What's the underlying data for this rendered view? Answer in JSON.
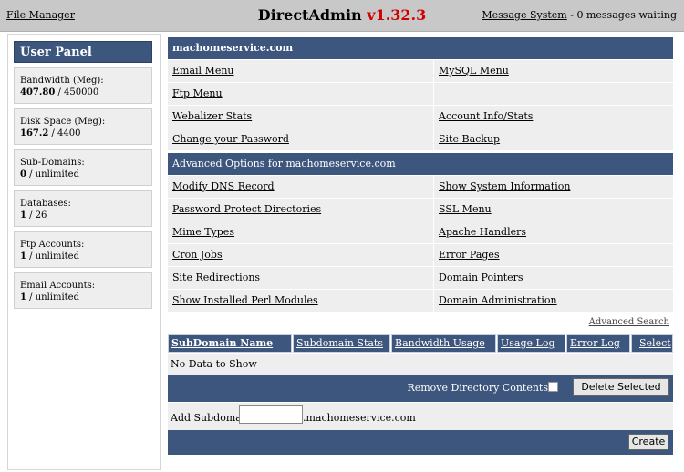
{
  "topbar": {
    "file_manager": "File Manager",
    "title_name": "DirectAdmin",
    "title_version": "v1.32.3",
    "message_system": "Message System",
    "messages_waiting": "- 0 messages waiting"
  },
  "sidebar": {
    "title": "User Panel",
    "stats": [
      {
        "label": "Bandwidth (Meg):",
        "used": "407.80",
        "limit": " / 450000"
      },
      {
        "label": "Disk Space (Meg):",
        "used": "167.2",
        "limit": " / 4400"
      },
      {
        "label": "Sub-Domains:",
        "used": "0",
        "limit": " / unlimited"
      },
      {
        "label": "Databases:",
        "used": "1",
        "limit": " / 26"
      },
      {
        "label": "Ftp Accounts:",
        "used": "1",
        "limit": " / unlimited"
      },
      {
        "label": "Email Accounts:",
        "used": "1",
        "limit": " / unlimited"
      }
    ]
  },
  "domain_header": "machomeservice.com",
  "menu_rows": [
    {
      "left": "Email Menu",
      "right": "MySQL Menu"
    },
    {
      "left": "Ftp Menu",
      "right": ""
    },
    {
      "left": "Webalizer Stats",
      "right": "Account Info/Stats"
    },
    {
      "left": "Change your Password",
      "right": "Site Backup"
    }
  ],
  "advanced_header": "Advanced Options for machomeservice.com",
  "advanced_rows": [
    {
      "left": "Modify DNS Record",
      "right": "Show System Information"
    },
    {
      "left": "Password Protect Directories",
      "right": "SSL Menu"
    },
    {
      "left": "Mime Types",
      "right": "Apache Handlers"
    },
    {
      "left": "Cron Jobs",
      "right": "Error Pages"
    },
    {
      "left": "Site Redirections",
      "right": "Domain Pointers"
    },
    {
      "left": "Show Installed Perl Modules",
      "right": "Domain Administration"
    }
  ],
  "advanced_search": "Advanced Search",
  "subdomain_table": {
    "columns": [
      "SubDomain Name",
      "Subdomain Stats",
      "Bandwidth Usage",
      "Usage Log",
      "Error Log",
      "Select"
    ],
    "empty_text": "No Data to Show"
  },
  "remove_dir_label": "Remove Directory Contents",
  "delete_button": "Delete Selected",
  "add_subdomain_label": "Add Subdomain:",
  "add_subdomain_value": "",
  "add_subdomain_suffix": ".machomeservice.com",
  "create_button": "Create"
}
